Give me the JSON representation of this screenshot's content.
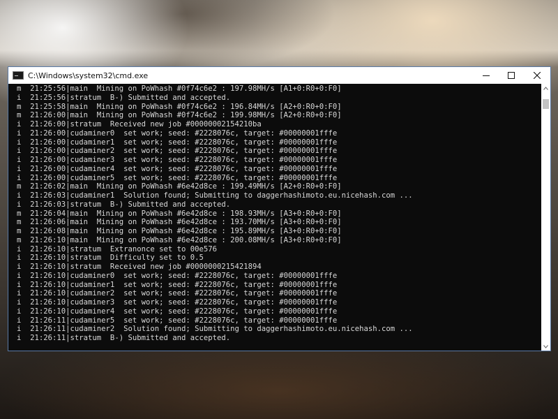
{
  "window": {
    "title": "C:\\Windows\\system32\\cmd.exe",
    "controls": {
      "minimize": "minimize-icon",
      "maximize": "maximize-icon",
      "close": "close-icon"
    }
  },
  "console": {
    "lines": [
      "m  21:25:56|main  Mining on PoWhash #0f74c6e2 : 197.98MH/s [A1+0:R0+0:F0]",
      "i  21:25:56|stratum  B-) Submitted and accepted.",
      "m  21:25:58|main  Mining on PoWhash #0f74c6e2 : 196.84MH/s [A2+0:R0+0:F0]",
      "m  21:26:00|main  Mining on PoWhash #0f74c6e2 : 199.98MH/s [A2+0:R0+0:F0]",
      "i  21:26:00|stratum  Received new job #00000002154210ba",
      "i  21:26:00|cudaminer0  set work; seed: #2228076c, target: #00000001fffe",
      "i  21:26:00|cudaminer1  set work; seed: #2228076c, target: #00000001fffe",
      "i  21:26:00|cudaminer2  set work; seed: #2228076c, target: #00000001fffe",
      "i  21:26:00|cudaminer3  set work; seed: #2228076c, target: #00000001fffe",
      "i  21:26:00|cudaminer4  set work; seed: #2228076c, target: #00000001fffe",
      "i  21:26:00|cudaminer5  set work; seed: #2228076c, target: #00000001fffe",
      "m  21:26:02|main  Mining on PoWhash #6e42d8ce : 199.49MH/s [A2+0:R0+0:F0]",
      "i  21:26:03|cudaminer1  Solution found; Submitting to daggerhashimoto.eu.nicehash.com ...",
      "i  21:26:03|stratum  B-) Submitted and accepted.",
      "m  21:26:04|main  Mining on PoWhash #6e42d8ce : 198.93MH/s [A3+0:R0+0:F0]",
      "m  21:26:06|main  Mining on PoWhash #6e42d8ce : 193.70MH/s [A3+0:R0+0:F0]",
      "m  21:26:08|main  Mining on PoWhash #6e42d8ce : 195.89MH/s [A3+0:R0+0:F0]",
      "m  21:26:10|main  Mining on PoWhash #6e42d8ce : 200.08MH/s [A3+0:R0+0:F0]",
      "i  21:26:10|stratum  Extranonce set to 00e576",
      "i  21:26:10|stratum  Difficulty set to 0.5",
      "i  21:26:10|stratum  Received new job #0000000215421894",
      "i  21:26:10|cudaminer0  set work; seed: #2228076c, target: #00000001fffe",
      "i  21:26:10|cudaminer1  set work; seed: #2228076c, target: #00000001fffe",
      "i  21:26:10|cudaminer2  set work; seed: #2228076c, target: #00000001fffe",
      "i  21:26:10|cudaminer3  set work; seed: #2228076c, target: #00000001fffe",
      "i  21:26:10|cudaminer4  set work; seed: #2228076c, target: #00000001fffe",
      "i  21:26:11|cudaminer5  set work; seed: #2228076c, target: #00000001fffe",
      "i  21:26:11|cudaminer2  Solution found; Submitting to daggerhashimoto.eu.nicehash.com ...",
      "i  21:26:11|stratum  B-) Submitted and accepted."
    ]
  },
  "colors": {
    "console_bg": "#0c0c0c",
    "console_text": "#d8d8d8",
    "titlebar_bg": "#ffffff",
    "window_border": "#5a7aa6"
  }
}
